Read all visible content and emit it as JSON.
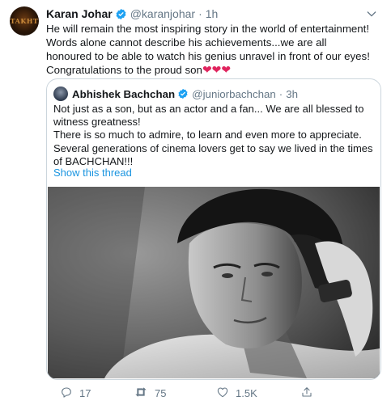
{
  "tweet": {
    "author_name": "Karan Johar",
    "handle": "@karanjohar",
    "time": "1h",
    "avatar_text": "TAKHT",
    "text": "He will remain the most inspiring story in the world of entertainment! Words alone cannot describe his achievements...we are all honoured to be able to watch his genius unravel in front of our eyes! Congratulations to the proud son",
    "hearts": "❤❤❤"
  },
  "quoted": {
    "author_name": "Abhishek Bachchan",
    "handle": "@juniorbachchan",
    "time": "3h",
    "line1": "Not just as a son, but as an actor and a fan... We are all blessed to witness greatness!",
    "line2": "There is so much to admire, to learn and even more to appreciate. Several generations of cinema lovers get to say we lived in the times of BACHCHAN!!!",
    "show_thread": "Show this thread"
  },
  "actions": {
    "replies": "17",
    "retweets": "75",
    "likes": "1.5K"
  },
  "colors": {
    "link": "#1b95e0",
    "verified": "#1da1f2",
    "heart": "#e0245e",
    "muted": "#657786"
  },
  "icons": [
    "verified-badge-icon",
    "chevron-down-icon",
    "reply-icon",
    "retweet-icon",
    "like-icon",
    "share-icon"
  ]
}
